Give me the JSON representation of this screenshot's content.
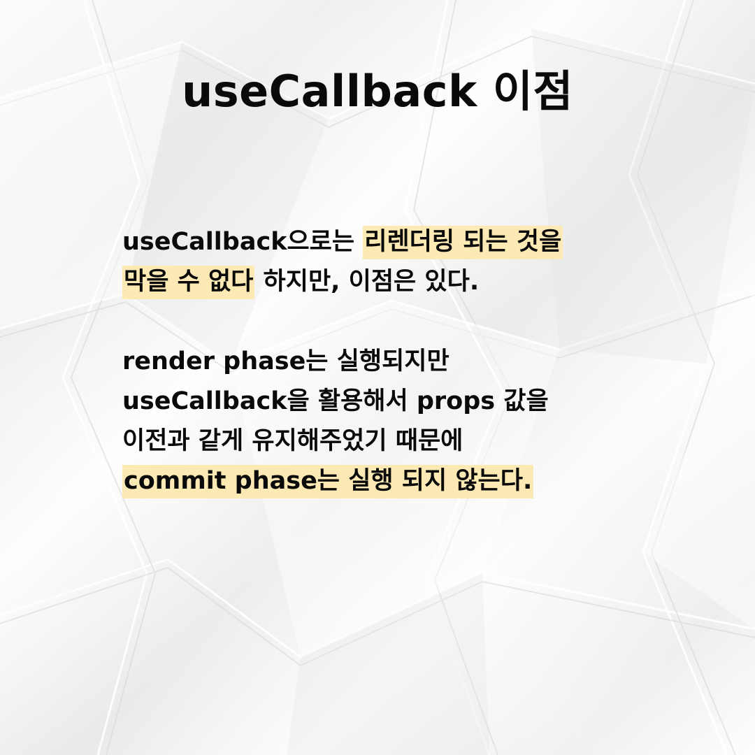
{
  "title": "useCallback 이점",
  "paragraph1": {
    "line1_plain": "useCallback으로는 ",
    "line1_highlight": "리렌더링 되는 것을",
    "line2_highlight": "막을 수 없다",
    "line2_plain": " 하지만, 이점은 있다."
  },
  "paragraph2": {
    "line1": "render phase는 실행되지만",
    "line2": "useCallback을 활용해서 props 값을",
    "line3": "이전과 같게 유지해주었기 때문에",
    "line4_highlight": "commit phase는 실행 되지 않는다."
  },
  "colors": {
    "highlight": "#fde9b4",
    "text": "#0a0a0a",
    "background": "#f2f2f2"
  }
}
